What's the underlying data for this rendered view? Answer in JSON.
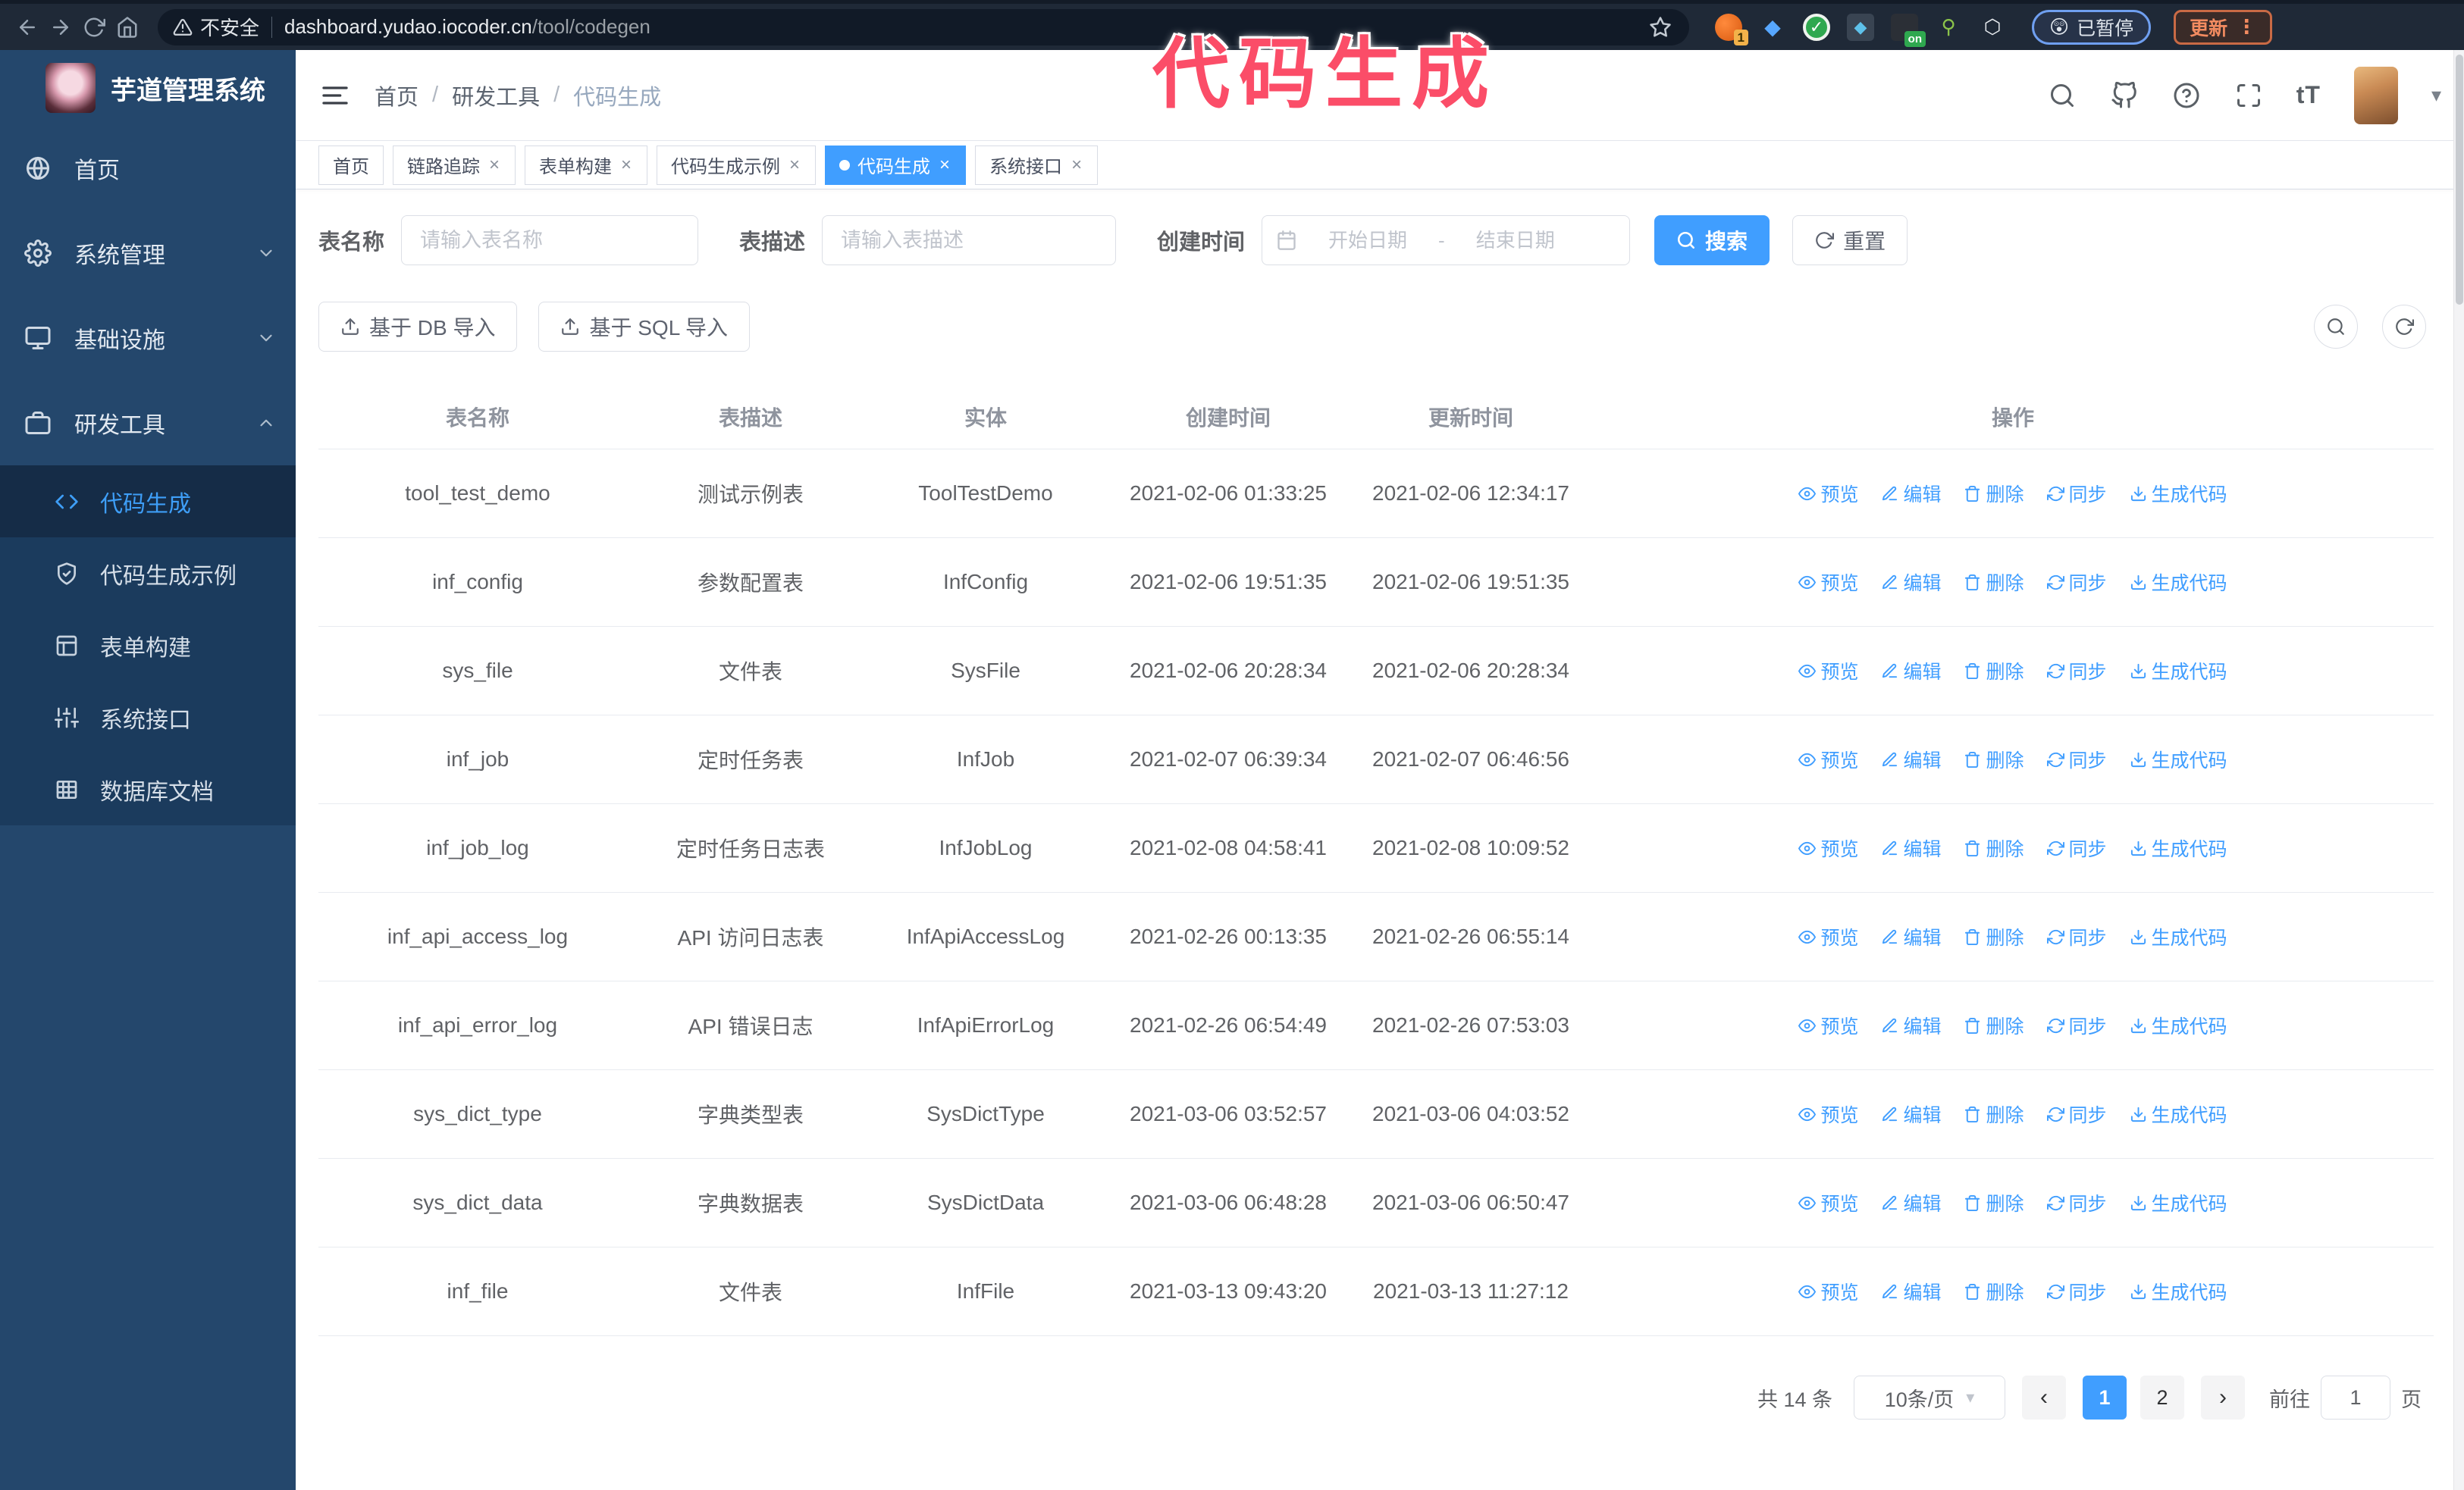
{
  "browser": {
    "security_label": "不安全",
    "url_host": "dashboard.yudao.iocoder.cn",
    "url_path": "/tool/codegen",
    "extension_badge": "1",
    "extension_on_badge": "on",
    "gem_glyph": "◆",
    "check_glyph": "✓",
    "grid_glyph": "◆",
    "figure_glyph": "⚲",
    "puzzle_glyph": "⬡",
    "paused_emoji": "😲",
    "paused_label": "已暂停",
    "update_label": "更新",
    "update_dots": "⋮",
    "star_glyph": "☆"
  },
  "annotation": {
    "text": "代码生成",
    "color": "#fb4d68"
  },
  "sidebar": {
    "title": "芋道管理系统",
    "items": [
      {
        "label": "首页"
      },
      {
        "label": "系统管理"
      },
      {
        "label": "基础设施"
      },
      {
        "label": "研发工具"
      }
    ],
    "subitems": [
      {
        "label": "代码生成",
        "active": true
      },
      {
        "label": "代码生成示例"
      },
      {
        "label": "表单构建"
      },
      {
        "label": "系统接口"
      },
      {
        "label": "数据库文档"
      }
    ]
  },
  "header": {
    "breadcrumb": [
      "首页",
      "研发工具",
      "代码生成"
    ],
    "separator": "/",
    "font_size_icon": "tT",
    "caret_glyph": "▾"
  },
  "tabs": [
    {
      "label": "首页",
      "closable": false,
      "active": false
    },
    {
      "label": "链路追踪",
      "closable": true,
      "active": false
    },
    {
      "label": "表单构建",
      "closable": true,
      "active": false
    },
    {
      "label": "代码生成示例",
      "closable": true,
      "active": false
    },
    {
      "label": "代码生成",
      "closable": true,
      "active": true
    },
    {
      "label": "系统接口",
      "closable": true,
      "active": false
    }
  ],
  "search": {
    "name_label": "表名称",
    "name_placeholder": "请输入表名称",
    "desc_label": "表描述",
    "desc_placeholder": "请输入表描述",
    "time_label": "创建时间",
    "start_placeholder": "开始日期",
    "range_separator": "-",
    "end_placeholder": "结束日期",
    "search_button": "搜索",
    "reset_button": "重置"
  },
  "toolbar": {
    "db_import": "基于 DB 导入",
    "sql_import": "基于 SQL 导入"
  },
  "table": {
    "columns": [
      "表名称",
      "表描述",
      "实体",
      "创建时间",
      "更新时间",
      "操作"
    ],
    "actions": [
      "预览",
      "编辑",
      "删除",
      "同步",
      "生成代码"
    ],
    "rows": [
      {
        "name": "tool_test_demo",
        "desc": "测试示例表",
        "entity": "ToolTestDemo",
        "created": "2021-02-06 01:33:25",
        "updated": "2021-02-06 12:34:17"
      },
      {
        "name": "inf_config",
        "desc": "参数配置表",
        "entity": "InfConfig",
        "created": "2021-02-06 19:51:35",
        "updated": "2021-02-06 19:51:35"
      },
      {
        "name": "sys_file",
        "desc": "文件表",
        "entity": "SysFile",
        "created": "2021-02-06 20:28:34",
        "updated": "2021-02-06 20:28:34"
      },
      {
        "name": "inf_job",
        "desc": "定时任务表",
        "entity": "InfJob",
        "created": "2021-02-07 06:39:34",
        "updated": "2021-02-07 06:46:56"
      },
      {
        "name": "inf_job_log",
        "desc": "定时任务日志表",
        "entity": "InfJobLog",
        "created": "2021-02-08 04:58:41",
        "updated": "2021-02-08 10:09:52"
      },
      {
        "name": "inf_api_access_log",
        "desc": "API 访问日志表",
        "entity": "InfApiAccessLog",
        "created": "2021-02-26 00:13:35",
        "updated": "2021-02-26 06:55:14"
      },
      {
        "name": "inf_api_error_log",
        "desc": "API 错误日志",
        "entity": "InfApiErrorLog",
        "created": "2021-02-26 06:54:49",
        "updated": "2021-02-26 07:53:03"
      },
      {
        "name": "sys_dict_type",
        "desc": "字典类型表",
        "entity": "SysDictType",
        "created": "2021-03-06 03:52:57",
        "updated": "2021-03-06 04:03:52"
      },
      {
        "name": "sys_dict_data",
        "desc": "字典数据表",
        "entity": "SysDictData",
        "created": "2021-03-06 06:48:28",
        "updated": "2021-03-06 06:50:47"
      },
      {
        "name": "inf_file",
        "desc": "文件表",
        "entity": "InfFile",
        "created": "2021-03-13 09:43:20",
        "updated": "2021-03-13 11:27:12"
      }
    ]
  },
  "pagination": {
    "total": "共 14 条",
    "page_size": "10条/页",
    "prev_glyph": "‹",
    "next_glyph": "›",
    "pages": [
      {
        "num": "1",
        "active": true
      },
      {
        "num": "2",
        "active": false
      }
    ],
    "goto_label": "前往",
    "goto_value": "1",
    "goto_suffix": "页"
  }
}
